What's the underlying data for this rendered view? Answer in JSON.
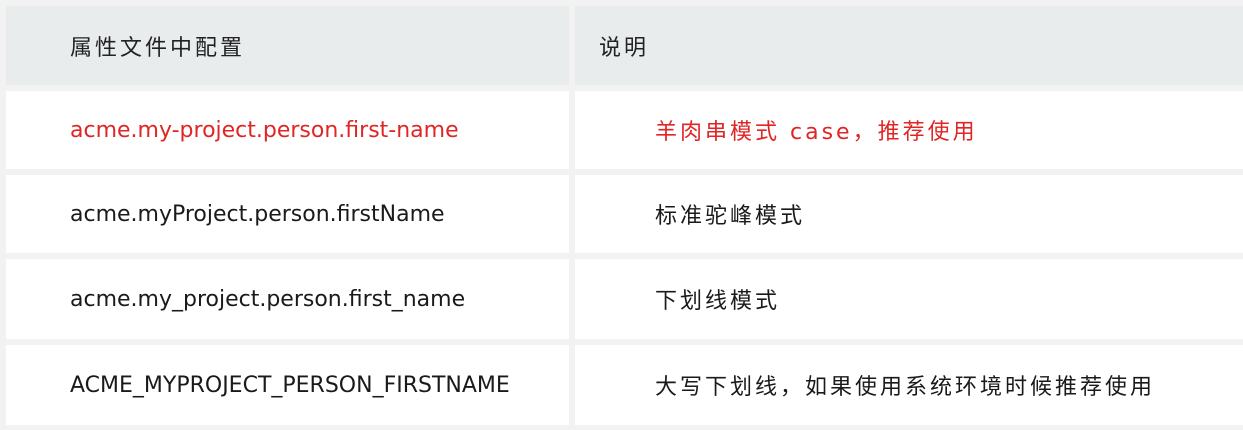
{
  "table": {
    "headers": [
      "属性文件中配置",
      "说明"
    ],
    "rows": [
      {
        "config": "acme.my-project.person.first-name",
        "desc": "羊肉串模式 case，推荐使用",
        "highlight": true
      },
      {
        "config": "acme.myProject.person.firstName",
        "desc": "标准驼峰模式",
        "highlight": false
      },
      {
        "config": "acme.my_project.person.first_name",
        "desc": "下划线模式",
        "highlight": false
      },
      {
        "config": "ACME_MYPROJECT_PERSON_FIRSTNAME",
        "desc": "大写下划线，如果使用系统环境时候推荐使用",
        "highlight": false
      }
    ]
  },
  "colors": {
    "highlight_text": "#e02525",
    "header_bg": "#e9ecec",
    "grid_bg": "#f2f2f2"
  }
}
